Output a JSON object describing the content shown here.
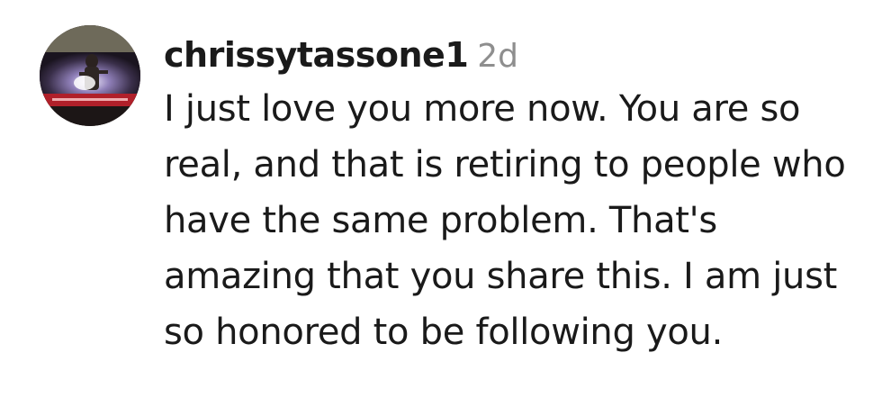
{
  "comment": {
    "username": "chrissytassone1",
    "timestamp": "2d",
    "text": "I just love you more now. You are so real, and that is retiring to people who have the same problem. That's amazing that you share this. I am just so honored to be following you."
  },
  "colors": {
    "text": "#1a1a1a",
    "timestamp": "#8e8e8e",
    "background": "#ffffff"
  },
  "icons": {
    "avatar": "profile-photo"
  }
}
